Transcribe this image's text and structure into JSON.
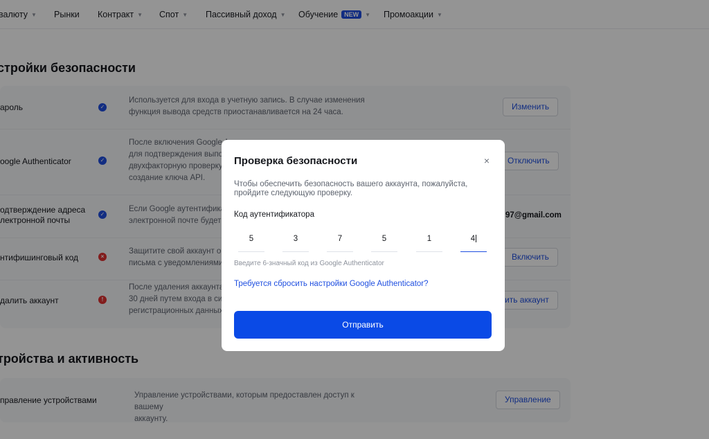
{
  "topnav": {
    "items": [
      {
        "label": "валюту",
        "caret": true
      },
      {
        "label": "Рынки",
        "caret": false
      },
      {
        "label": "Контракт",
        "caret": true
      },
      {
        "label": "Спот",
        "caret": true
      },
      {
        "label": "Пассивный доход",
        "caret": true
      },
      {
        "label": "Обучение",
        "badge": "NEW",
        "caret": true
      },
      {
        "label": "Промоакции",
        "caret": true
      }
    ]
  },
  "security": {
    "title": "стройки безопасности",
    "rows": [
      {
        "label": "ароль",
        "status": "ok",
        "description": "Используется для входа в учетную запись. В случае изменения\nфункция вывода средств приостанавливается на 24 часа.",
        "button": "Изменить"
      },
      {
        "label": "oogle Authenticator",
        "status": "ok",
        "description": "После включения Google A\nдля подтверждения выпо\nдвухфакторную проверку\nсоздание ключа API.",
        "button": "Отключить"
      },
      {
        "label": "одтверждение адреса\nлектронной почты",
        "status": "ok",
        "description": "Если Google аутентифика\nэлектронной почте будет",
        "value": "97@gmail.com"
      },
      {
        "label": "нтифишинговый код",
        "status": "bad",
        "description": "Защитите свой аккаунт о\nписьма с уведомлениями",
        "button": "Включить"
      },
      {
        "label": "далить аккаунт",
        "status": "warn",
        "description": "После удаления аккаунта\n30 дней путем входа в сис\nрегистрационных данных",
        "button": "ить аккаунт"
      }
    ]
  },
  "devices": {
    "title": "тройства и активность",
    "rows": [
      {
        "label": "правление устройствами",
        "description": "Управление устройствами, которым предоставлен доступ к вашему\nаккаунту.",
        "button": "Управление"
      }
    ]
  },
  "modal": {
    "title": "Проверка безопасности",
    "close_icon": "×",
    "text": "Чтобы обеспечить безопасность вашего аккаунта, пожалуйста,\nпройдите следующую проверку.",
    "code_label": "Код аутентификатора",
    "code_digits": [
      "5",
      "3",
      "7",
      "5",
      "1",
      "4"
    ],
    "active_digit_index": 5,
    "hint": "Введите 6-значный код из Google Authenticator",
    "reset_link": "Требуется сбросить настройки Google Authenticator?",
    "submit_label": "Отправить"
  },
  "colors": {
    "accent": "#1f4fe0",
    "submit": "#0a4ae6",
    "error": "#e03131",
    "overlay": "rgba(0,0,0,0.42)"
  }
}
